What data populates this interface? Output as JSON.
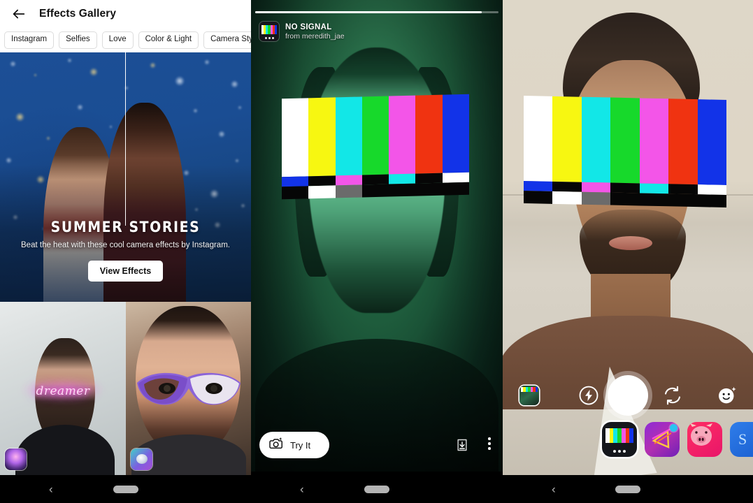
{
  "panel1": {
    "name": "effects-gallery",
    "header": {
      "back_icon": "back-arrow-icon",
      "title": "Effects Gallery"
    },
    "tabs": [
      {
        "label": "Instagram"
      },
      {
        "label": "Selfies"
      },
      {
        "label": "Love"
      },
      {
        "label": "Color & Light"
      },
      {
        "label": "Camera Style"
      }
    ],
    "hero": {
      "title": "SUMMER STORIES",
      "subtitle": "Beat the heat with these cool camera effects by Instagram.",
      "button": "View Effects"
    },
    "tiles": [
      {
        "name": "effect-tile-dreamer",
        "overlay_text": "dreamer",
        "badge_icon": "orb-effect-badge-icon"
      },
      {
        "name": "effect-tile-mask",
        "overlay_text": "",
        "badge_icon": "face-effect-badge-icon"
      }
    ]
  },
  "panel2": {
    "name": "effect-preview",
    "progress_percent": 93,
    "effect": {
      "avatar_icon": "tv-test-pattern-icon",
      "title": "NO SIGNAL",
      "author": "from meredith_jae"
    },
    "try_button": {
      "label": "Try It",
      "icon": "camera-sparkle-icon"
    },
    "save_icon": "save-effect-icon",
    "more_icon": "more-options-icon"
  },
  "panel3": {
    "name": "camera-capture",
    "controls": {
      "gallery_icon": "gallery-thumbnail-icon",
      "flash_icon": "flash-icon",
      "shutter_icon": "shutter-button",
      "flip_icon": "flip-camera-icon",
      "face_effects_icon": "face-effects-icon"
    },
    "effects_tray": [
      {
        "name": "effect-no-signal",
        "icon": "tv-test-pattern-icon",
        "selected": true
      },
      {
        "name": "effect-neon-triangle",
        "icon": "neon-triangle-icon",
        "selected": false,
        "has_badge": true
      },
      {
        "name": "effect-pig-face",
        "icon": "pig-face-icon",
        "selected": false
      },
      {
        "name": "effect-blue",
        "icon": "blue-effect-icon",
        "selected": false
      }
    ]
  },
  "navbars": [
    {
      "back_icon": "nav-back-icon",
      "home_icon": "nav-home-pill"
    },
    {
      "back_icon": "nav-back-icon",
      "home_icon": "nav-home-pill"
    },
    {
      "back_icon": "nav-back-icon",
      "home_icon": "nav-home-pill"
    }
  ],
  "colors": {
    "bar_white": "#ffffff",
    "bar_yellow": "#f7f711",
    "bar_cyan": "#12e7e7",
    "bar_green": "#17d92b",
    "bar_magenta": "#f355e8",
    "bar_red": "#f03311",
    "bar_blue": "#1233e8",
    "bar_black": "#060606",
    "bar_gray": "#6b6b6b",
    "accent_white": "#ffffff",
    "panel1_bg": "#ffffff",
    "chip_border": "#dcdcdc"
  }
}
